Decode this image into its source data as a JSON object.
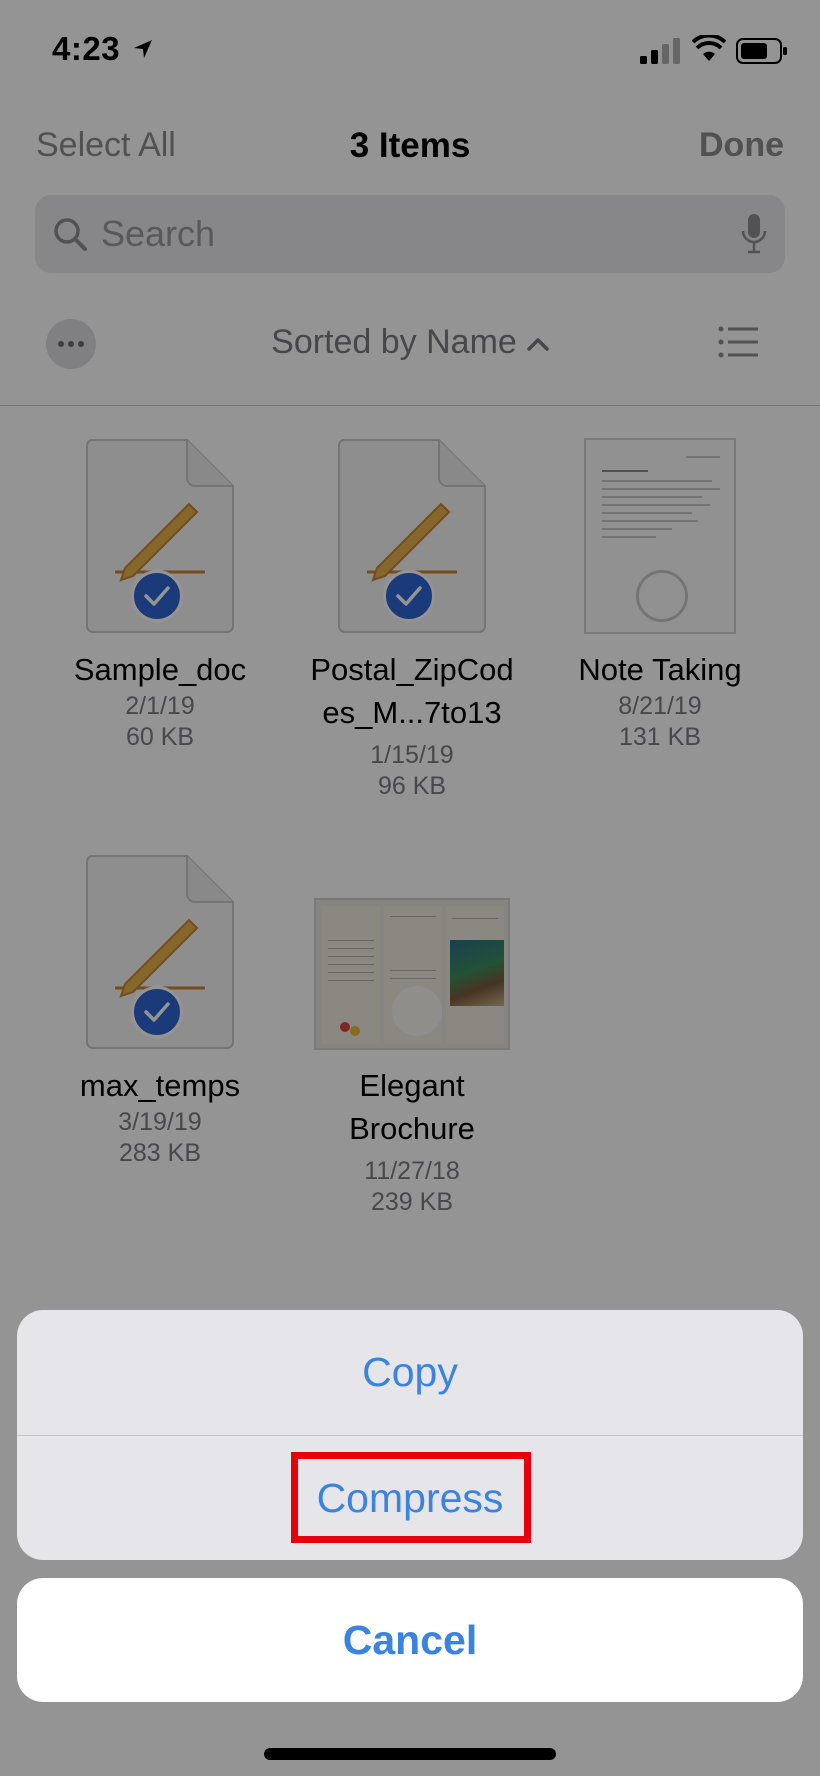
{
  "status_bar": {
    "time": "4:23",
    "icons": [
      "location-arrow-icon",
      "cellular-signal-icon",
      "wifi-icon",
      "battery-icon"
    ]
  },
  "nav": {
    "left": "Select All",
    "title": "3 Items",
    "right": "Done"
  },
  "search": {
    "placeholder": "Search",
    "icons": [
      "search-icon",
      "microphone-icon"
    ]
  },
  "sort": {
    "label": "Sorted by Name",
    "icons": [
      "more-icon",
      "chevron-up-icon",
      "list-view-icon"
    ]
  },
  "files": [
    {
      "name_line1": "Sample_doc",
      "name_line2": "",
      "date": "2/1/19",
      "size": "60 KB",
      "selected": true,
      "kind": "pages-doc"
    },
    {
      "name_line1": "Postal_ZipCod",
      "name_line2": "es_M...7to13",
      "date": "1/15/19",
      "size": "96 KB",
      "selected": true,
      "kind": "pages-doc"
    },
    {
      "name_line1": "Note Taking",
      "name_line2": "",
      "date": "8/21/19",
      "size": "131 KB",
      "selected": false,
      "kind": "note-preview"
    },
    {
      "name_line1": "max_temps",
      "name_line2": "",
      "date": "3/19/19",
      "size": "283 KB",
      "selected": true,
      "kind": "pages-doc"
    },
    {
      "name_line1": "Elegant",
      "name_line2": "Brochure",
      "date": "11/27/18",
      "size": "239 KB",
      "selected": false,
      "kind": "brochure-preview"
    }
  ],
  "action_sheet": {
    "options": [
      "Copy",
      "Compress"
    ],
    "cancel": "Cancel"
  },
  "colors": {
    "accent": "#3a83e0",
    "check": "#2e64d0",
    "highlight": "#e8000b",
    "pencil": "#d9a441"
  }
}
